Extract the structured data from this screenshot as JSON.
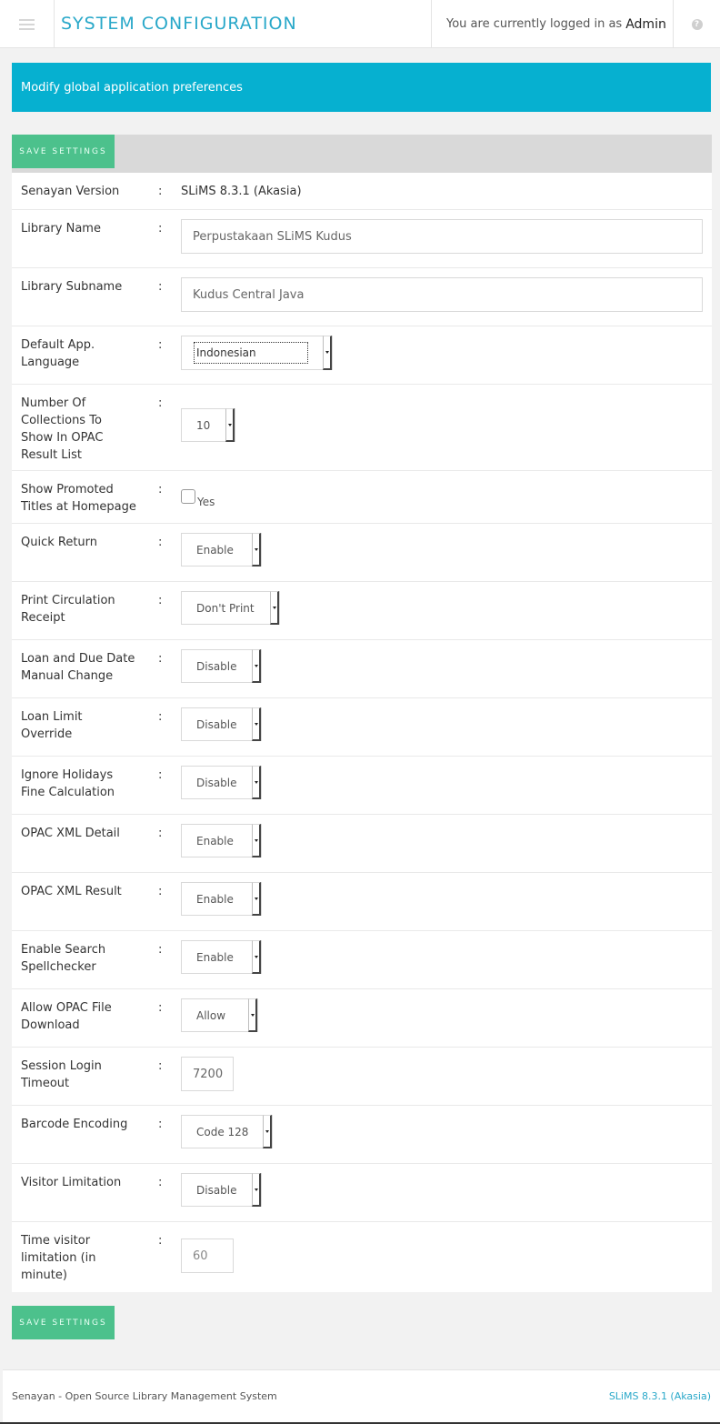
{
  "header": {
    "title": "SYSTEM CONFIGURATION",
    "login_prefix": "You are currently logged in as",
    "login_user": "Admin"
  },
  "info_bar": {
    "text": "Modify global application preferences"
  },
  "buttons": {
    "save_label": "SAVE SETTINGS"
  },
  "colors": {
    "accent": "#06b0d0",
    "title": "#29a8c9",
    "save_button": "#4cc18c"
  },
  "icons": {
    "menu": "hamburger-menu-icon",
    "help": "question-circle-icon",
    "dropdown": "caret-down-icon"
  },
  "form": {
    "senayan_version": {
      "label": "Senayan Version",
      "value": "SLiMS 8.3.1 (Akasia)"
    },
    "library_name": {
      "label": "Library Name",
      "value": "Perpustakaan SLiMS Kudus"
    },
    "library_subname": {
      "label": "Library Subname",
      "value": "Kudus Central Java"
    },
    "default_language": {
      "label": "Default App. Language",
      "value": "Indonesian"
    },
    "collections_count": {
      "label": "Number Of Collections To Show In OPAC Result List",
      "value": "10"
    },
    "promoted_titles": {
      "label": "Show Promoted Titles at Homepage",
      "option_label": "Yes",
      "checked": false
    },
    "quick_return": {
      "label": "Quick Return",
      "value": "Enable"
    },
    "print_receipt": {
      "label": "Print Circulation Receipt",
      "value": "Don't Print"
    },
    "loan_date_change": {
      "label": "Loan and Due Date Manual Change",
      "value": "Disable"
    },
    "loan_limit_override": {
      "label": "Loan Limit Override",
      "value": "Disable"
    },
    "ignore_holidays": {
      "label": "Ignore Holidays Fine Calculation",
      "value": "Disable"
    },
    "opac_xml_detail": {
      "label": "OPAC XML Detail",
      "value": "Enable"
    },
    "opac_xml_result": {
      "label": "OPAC XML Result",
      "value": "Enable"
    },
    "spellchecker": {
      "label": "Enable Search Spellchecker",
      "value": "Enable"
    },
    "opac_file_download": {
      "label": "Allow OPAC File Download",
      "value": "Allow"
    },
    "session_timeout": {
      "label": "Session Login Timeout",
      "value": "7200"
    },
    "barcode_encoding": {
      "label": "Barcode Encoding",
      "value": "Code 128"
    },
    "visitor_limitation": {
      "label": "Visitor Limitation",
      "value": "Disable"
    },
    "visitor_time_limit": {
      "label": "Time visitor limitation (in minute)",
      "value": "60"
    }
  },
  "footer": {
    "left": "Senayan - Open Source Library Management System",
    "right": "SLiMS 8.3.1 (Akasia)"
  }
}
